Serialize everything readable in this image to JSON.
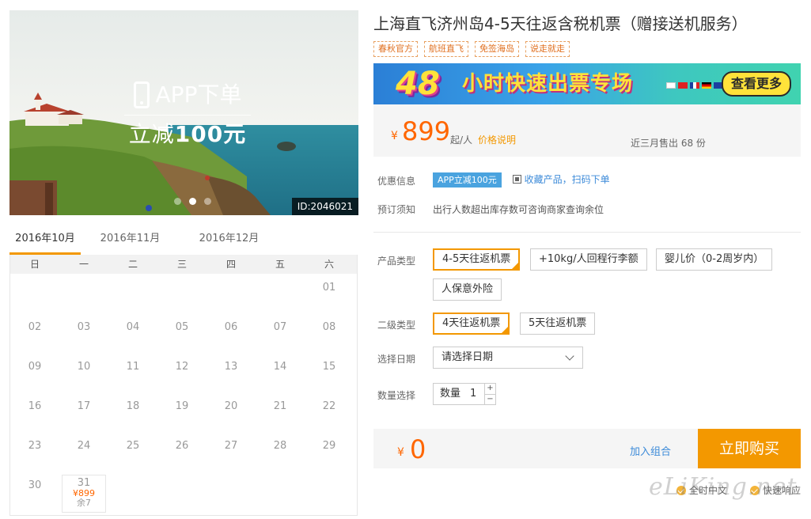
{
  "hero": {
    "promo_line1": "APP下单",
    "promo_line2_prefix": "立减",
    "promo_line2_amount": "100元",
    "image_id": "ID:2046021"
  },
  "calendar": {
    "months": [
      "2016年10月",
      "2016年11月",
      "2016年12月"
    ],
    "weekdays": [
      "日",
      "一",
      "二",
      "三",
      "四",
      "五",
      "六"
    ],
    "leading_blanks": 6,
    "days": [
      "01",
      "02",
      "03",
      "04",
      "05",
      "06",
      "07",
      "08",
      "09",
      "10",
      "11",
      "12",
      "13",
      "14",
      "15",
      "16",
      "17",
      "18",
      "19",
      "20",
      "21",
      "22",
      "23",
      "24",
      "25",
      "26",
      "27",
      "28",
      "29",
      "30",
      "31"
    ],
    "priced_day": {
      "day": "31",
      "price": "¥899",
      "remaining": "余7"
    }
  },
  "product": {
    "title": "上海直飞济州岛4-5天往返含税机票（赠接送机服务）",
    "tags": [
      "春秋官方",
      "航班直飞",
      "免签海岛",
      "说走就走"
    ]
  },
  "banner": {
    "number": "48",
    "text": "小时快速出票专场",
    "button": "查看更多"
  },
  "price": {
    "symbol": "¥",
    "value": "899",
    "unit": "起/人",
    "note": "价格说明",
    "sold": "近三月售出 68 份"
  },
  "discount": {
    "label": "优惠信息",
    "badge": "APP立减100元",
    "link": "收藏产品，扫码下单"
  },
  "booking_notice": {
    "label": "预订须知",
    "text": "出行人数超出库存数可咨询商家查询余位"
  },
  "product_type": {
    "label": "产品类型",
    "options": [
      "4-5天往返机票",
      "+10kg/人回程行李额",
      "婴儿价（0-2周岁内）",
      "人保意外险"
    ]
  },
  "sub_type": {
    "label": "二级类型",
    "options": [
      "4天往返机票",
      "5天往返机票"
    ]
  },
  "date_select": {
    "label": "选择日期",
    "value": "请选择日期"
  },
  "quantity": {
    "label": "数量选择",
    "prefix": "数量",
    "value": "1",
    "plus": "+",
    "minus": "−"
  },
  "total": {
    "symbol": "¥",
    "value": "0",
    "add_combo": "加入组合",
    "buy": "立即购买"
  },
  "services": [
    "全时中文",
    "快速响应"
  ],
  "watermark": "eLiKing.net"
}
